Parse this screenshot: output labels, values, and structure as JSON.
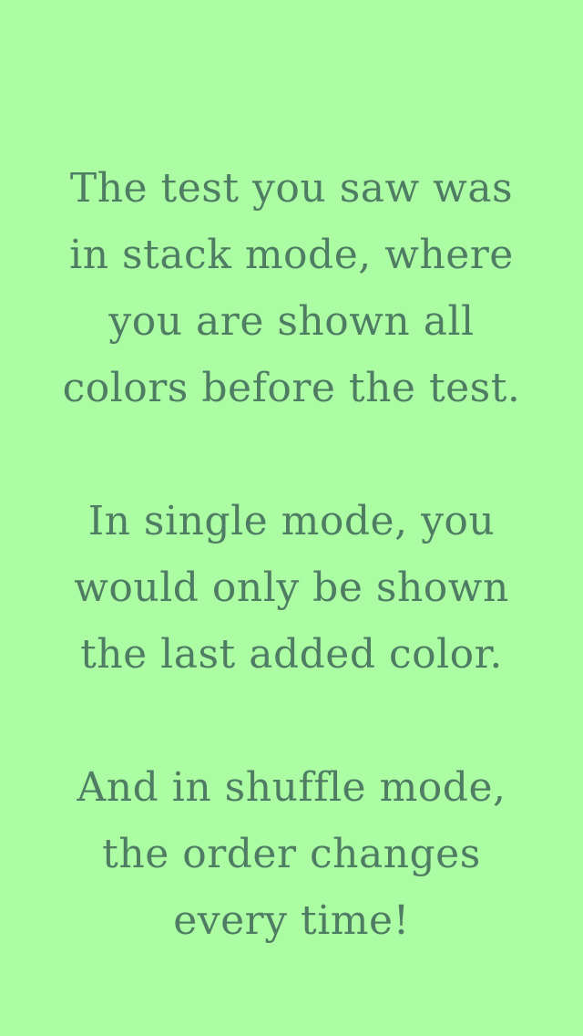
{
  "colors": {
    "background": "#acfca4",
    "text": "#4f7d63"
  },
  "message": {
    "paragraph_1": [
      "The test you saw was",
      "in stack mode, where",
      "you are shown all",
      "colors before the test."
    ],
    "paragraph_2": [
      "In single mode, you",
      "would only be shown",
      "the last added color."
    ],
    "paragraph_3": [
      "And in shuffle mode,",
      "the order changes",
      "every time!"
    ]
  }
}
